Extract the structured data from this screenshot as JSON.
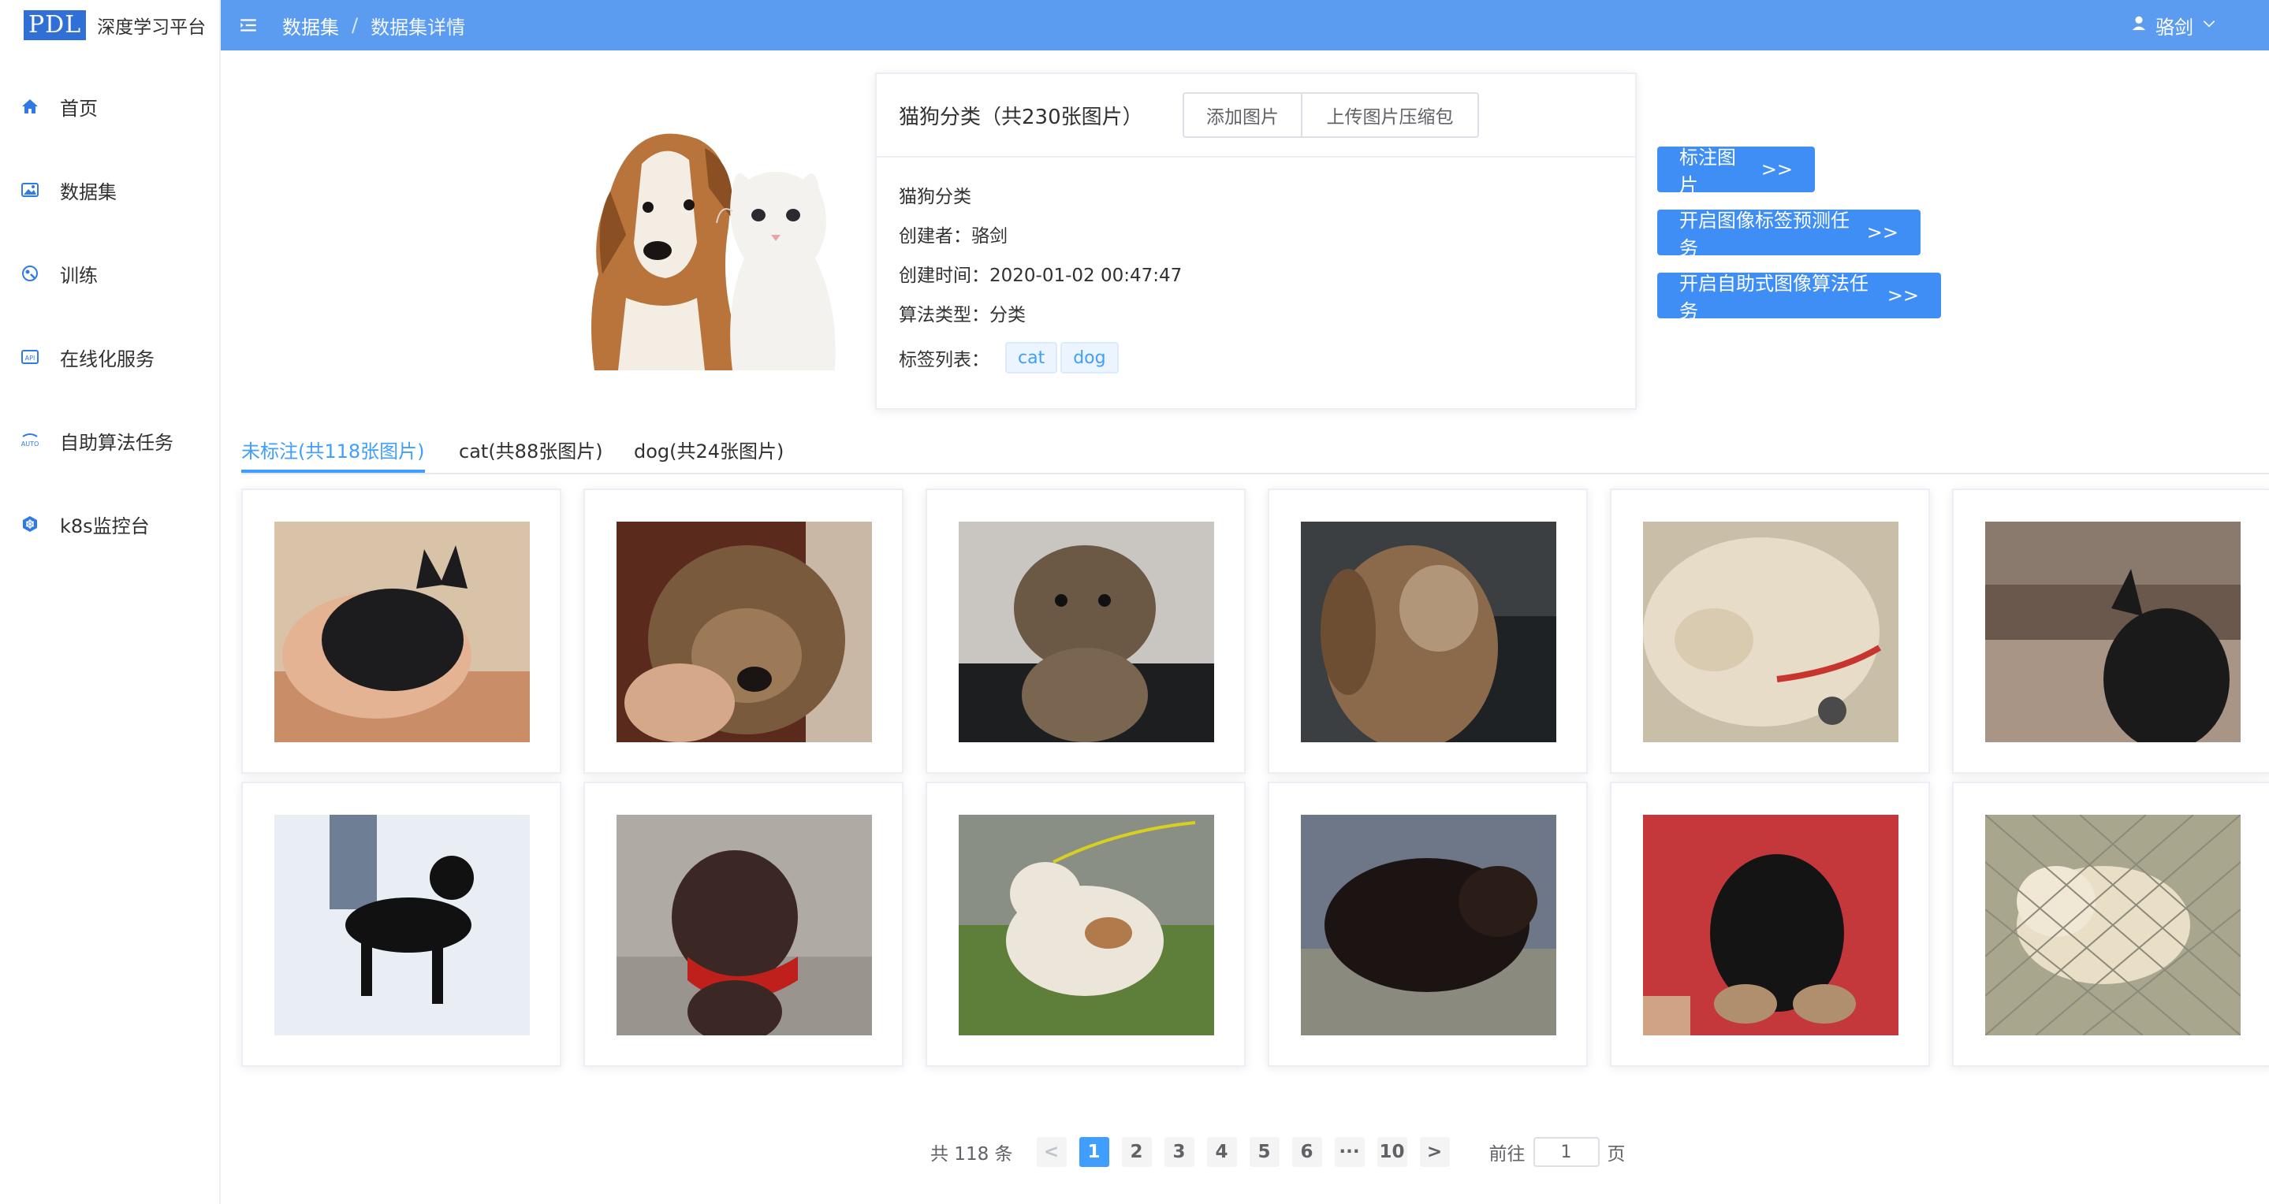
{
  "brand": {
    "mark": "PDL",
    "name": "深度学习平台"
  },
  "sidebar": {
    "items": [
      {
        "label": "首页",
        "icon": "home-icon"
      },
      {
        "label": "数据集",
        "icon": "image-icon"
      },
      {
        "label": "训练",
        "icon": "training-icon"
      },
      {
        "label": "在线化服务",
        "icon": "api-icon"
      },
      {
        "label": "自助算法任务",
        "icon": "auto-task-icon"
      },
      {
        "label": "k8s监控台",
        "icon": "kubernetes-icon"
      }
    ]
  },
  "header": {
    "breadcrumb": [
      "数据集",
      "数据集详情"
    ],
    "user": "骆剑"
  },
  "dataset": {
    "title": "猫狗分类（共230张图片）",
    "add_button": "添加图片",
    "upload_button": "上传图片压缩包",
    "name": "猫狗分类",
    "creator": "创建者：骆剑",
    "created_at": "创建时间：2020-01-02 00:47:47",
    "algorithm": "算法类型：分类",
    "tags_label": "标签列表：",
    "tags": [
      "cat",
      "dog"
    ]
  },
  "actions": {
    "annotate": "标注图片",
    "predict": "开启图像标签预测任务",
    "auto_algo": "开启自助式图像算法任务",
    "arrow": ">>"
  },
  "tabs": [
    {
      "label": "未标注(共118张图片)",
      "active": true
    },
    {
      "label": "cat(共88张图片)",
      "active": false
    },
    {
      "label": "dog(共24张图片)",
      "active": false
    }
  ],
  "images": [
    {
      "subject": "black kitten held in hand",
      "colors": [
        "#d8c3a8",
        "#1c1b1d",
        "#c98e67"
      ]
    },
    {
      "subject": "terrier puppy held in hands",
      "colors": [
        "#5a2a1c",
        "#7a5a3d",
        "#d6a88a"
      ]
    },
    {
      "subject": "yorkie on black mat",
      "colors": [
        "#c9c6c2",
        "#6b5845",
        "#1d1e20"
      ]
    },
    {
      "subject": "brown long-haired dog",
      "colors": [
        "#3b3f42",
        "#8a6a4a",
        "#b2967a"
      ]
    },
    {
      "subject": "white terrier with red collar",
      "colors": [
        "#c9bfa8",
        "#e6dcc8",
        "#c8342e"
      ]
    },
    {
      "subject": "black dog on carpet",
      "colors": [
        "#6a584c",
        "#1a1a1b",
        "#a89586"
      ]
    },
    {
      "subject": "black dog in snow",
      "colors": [
        "#e9eef4",
        "#111111",
        "#6e7e94"
      ]
    },
    {
      "subject": "brown pit bull with red bandana",
      "colors": [
        "#b0aaa4",
        "#3b2824",
        "#c0201c"
      ]
    },
    {
      "subject": "white and brown puppy on grass",
      "colors": [
        "#5e7f3a",
        "#ece6da",
        "#b07a4a"
      ]
    },
    {
      "subject": "fluffy black dog outdoors",
      "colors": [
        "#6d7788",
        "#1c1412",
        "#8a8a7f"
      ]
    },
    {
      "subject": "black puppy held by person in red shirt",
      "colors": [
        "#c4383c",
        "#141414",
        "#b08f6f"
      ]
    },
    {
      "subject": "cream puppy behind fence",
      "colors": [
        "#a8a68c",
        "#e9dfc6",
        "#8c8a7a"
      ]
    }
  ],
  "pagination": {
    "total": "共 118 条",
    "prev": "<",
    "pages": [
      "1",
      "2",
      "3",
      "4",
      "5",
      "6",
      "···",
      "10"
    ],
    "current": "1",
    "next": ">",
    "goto_prefix": "前往",
    "goto_value": "1",
    "goto_suffix": "页"
  },
  "colors": {
    "header": "#5b9cf1",
    "primary": "#3f8ef6",
    "tab_active": "#409eff"
  }
}
